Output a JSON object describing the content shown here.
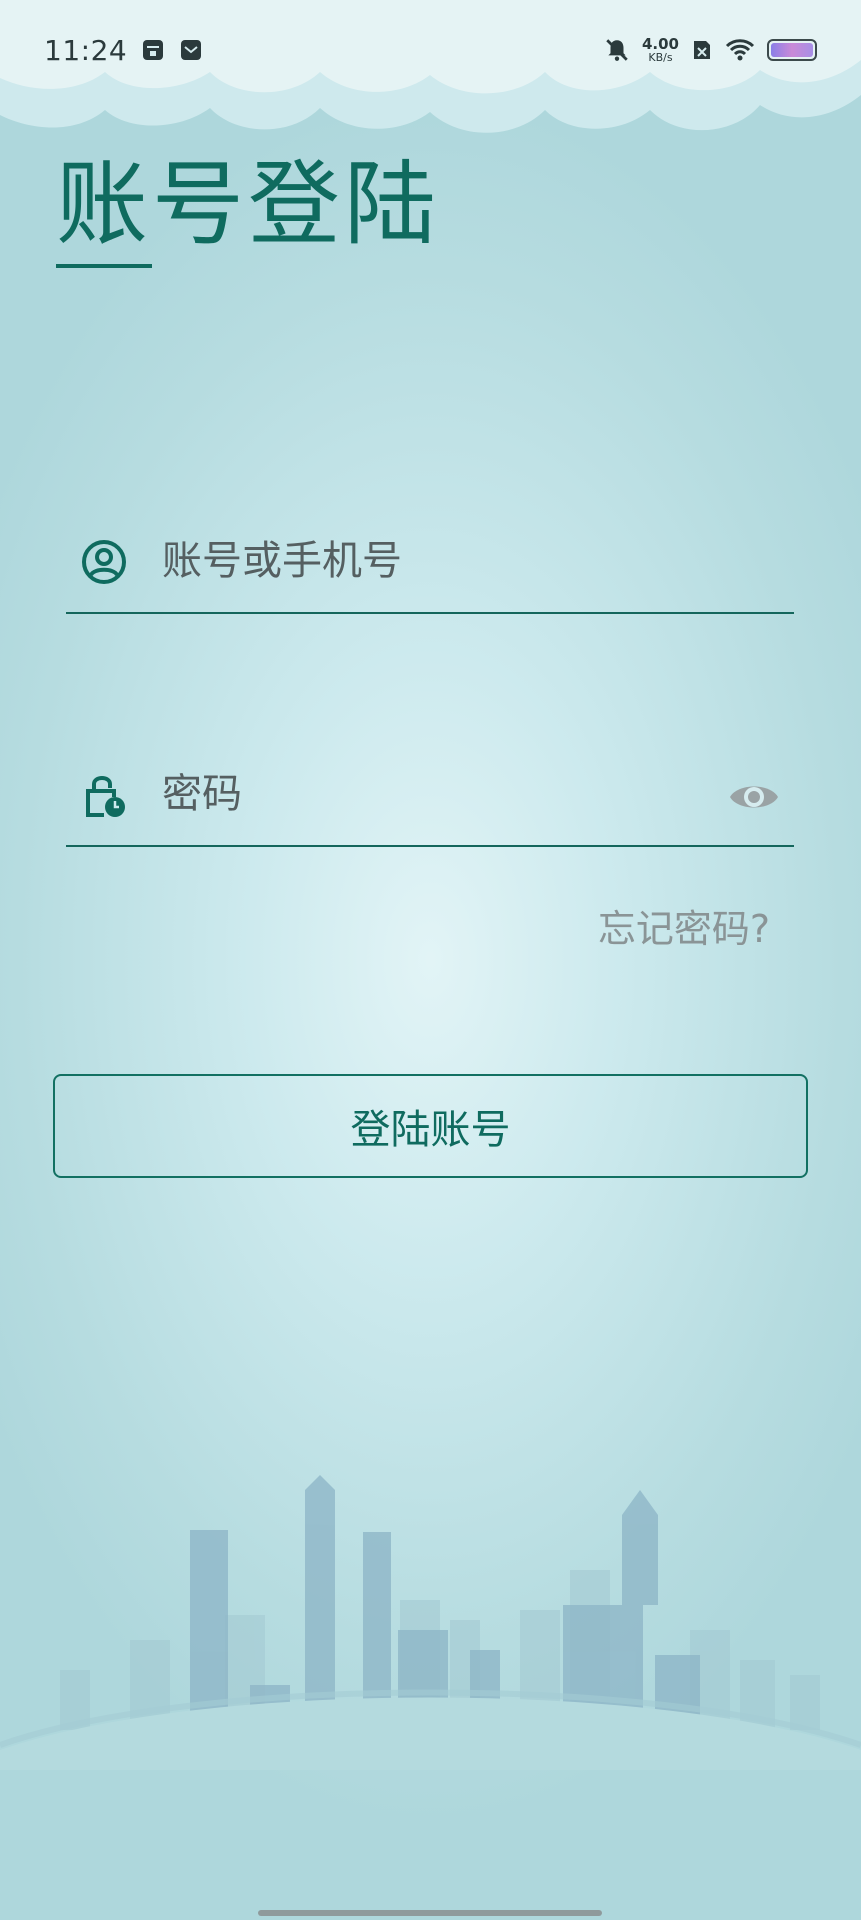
{
  "status_bar": {
    "time": "11:24",
    "network_speed_value": "4.00",
    "network_speed_unit": "KB/s",
    "left_icons": [
      "calendar-app-icon",
      "mail-app-icon"
    ],
    "right_icons": [
      "mute-bell-icon",
      "no-sim-icon",
      "wifi-icon",
      "battery-icon"
    ]
  },
  "header": {
    "title": "账号登陆"
  },
  "form": {
    "account": {
      "placeholder": "账号或手机号",
      "value": "",
      "icon": "user-circle-icon"
    },
    "password": {
      "placeholder": "密码",
      "value": "",
      "icon": "lock-clock-icon",
      "toggle_icon": "eye-icon"
    },
    "forgot_label": "忘记密码?",
    "login_label": "登陆账号"
  },
  "colors": {
    "primary": "#0f6b5f",
    "background_center": "#e2f4f6",
    "background_edge": "#aed7dc",
    "hint": "#8a9496"
  }
}
